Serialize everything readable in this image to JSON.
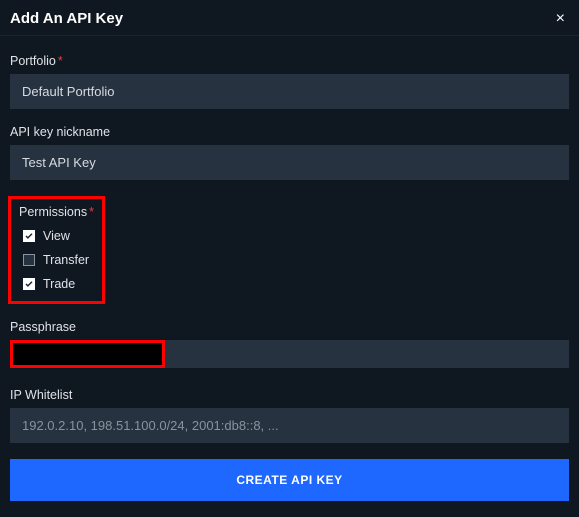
{
  "header": {
    "title": "Add An API Key",
    "close": "×"
  },
  "portfolio": {
    "label": "Portfolio",
    "value": "Default Portfolio"
  },
  "nickname": {
    "label": "API key nickname",
    "value": "Test API Key"
  },
  "permissions": {
    "label": "Permissions",
    "items": [
      {
        "label": "View",
        "checked": true
      },
      {
        "label": "Transfer",
        "checked": false
      },
      {
        "label": "Trade",
        "checked": true
      }
    ]
  },
  "passphrase": {
    "label": "Passphrase",
    "value": ""
  },
  "whitelist": {
    "label": "IP Whitelist",
    "placeholder": "192.0.2.10, 198.51.100.0/24, 2001:db8::8, ..."
  },
  "submit": {
    "label": "CREATE API KEY"
  }
}
